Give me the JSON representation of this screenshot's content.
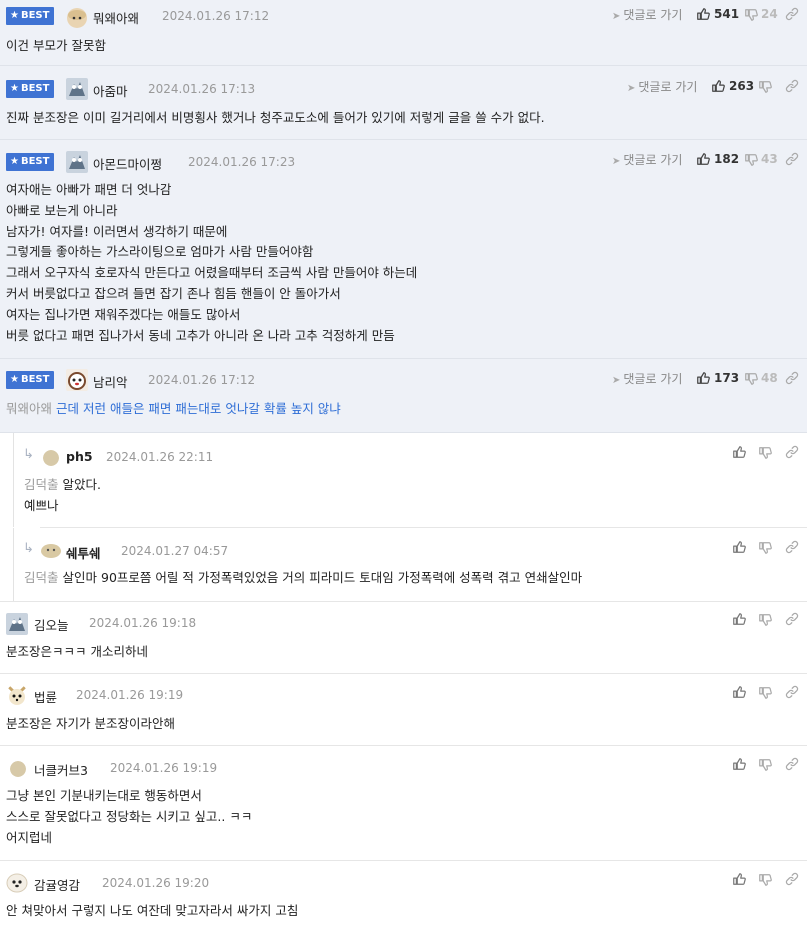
{
  "ui": {
    "best_label": "BEST",
    "goto_label": "댓글로 가기",
    "accent_color": "#3f73d3",
    "mention_color": "#2f6ed6"
  },
  "comments": [
    {
      "nick": "뭐왜아왜",
      "date": "2024.01.26 17:12",
      "up": "541",
      "down": "24",
      "lines": [
        "이건 부모가 잘못함"
      ]
    },
    {
      "nick": "아줌마",
      "date": "2024.01.26 17:13",
      "up": "263",
      "down": "",
      "lines": [
        "진짜 분조장은 이미 길거리에서 비명횡사 했거나 청주교도소에 들어가 있기에 저렇게 글을 쓸 수가 없다."
      ]
    },
    {
      "nick": "아몬드마이쩡",
      "date": "2024.01.26 17:23",
      "up": "182",
      "down": "43",
      "lines": [
        "여자애는 아빠가 패면 더 엇나감",
        "아빠로 보는게 아니라",
        "남자가! 여자를! 이러면서 생각하기 때문에",
        "그렇게들 좋아하는 가스라이팅으로 엄마가 사람 만들어야함",
        "그래서 오구자식 호로자식 만든다고 어렸을때부터 조금씩 사람 만들어야 하는데",
        "커서 버릇없다고 잡으려 들면 잡기 존나 힘듬 핸들이 안 돌아가서",
        "여자는 집나가면 재워주겠다는 애들도 많아서",
        "버릇 없다고 패면 집나가서 동네 고추가 아니라 온 나라 고추 걱정하게 만듬"
      ]
    },
    {
      "nick": "남리악",
      "date": "2024.01.26 17:12",
      "up": "173",
      "down": "48",
      "mention": "뭐왜아왜",
      "line": "근데 저런 애들은 패면 패는대로 엇나갈 확률 높지 않냐"
    },
    {
      "nick": "ph5",
      "date": "2024.01.26 22:11",
      "mention": "김덕출",
      "lines": [
        "알았다.",
        "예쁘나"
      ]
    },
    {
      "nick": "쉐투쉐",
      "date": "2024.01.27 04:57",
      "mention": "김덕출",
      "line": "살인마 90프로쯤 어릴 적 가정폭력있었음 거의 피라미드 토대임 가정폭력에 성폭력 겪고 연쇄살인마"
    },
    {
      "nick": "김오늘",
      "date": "2024.01.26 19:18",
      "line": "분조장은ㅋㅋㅋ 개소리하네"
    },
    {
      "nick": "법륜",
      "date": "2024.01.26 19:19",
      "line": "분조장은 자기가 분조장이라안해"
    },
    {
      "nick": "너클커브3",
      "date": "2024.01.26 19:19",
      "lines": [
        "그냥 본인 기분내키는대로 행동하면서",
        "스스로 잘못없다고 정당화는 시키고 싶고.. ㅋㅋ",
        "어지럽네"
      ]
    },
    {
      "nick": "감귤영감",
      "date": "2024.01.26 19:20",
      "line": "안 쳐맞아서 구렇지 나도 여잔데 맞고자라서 싸가지 고침"
    }
  ]
}
